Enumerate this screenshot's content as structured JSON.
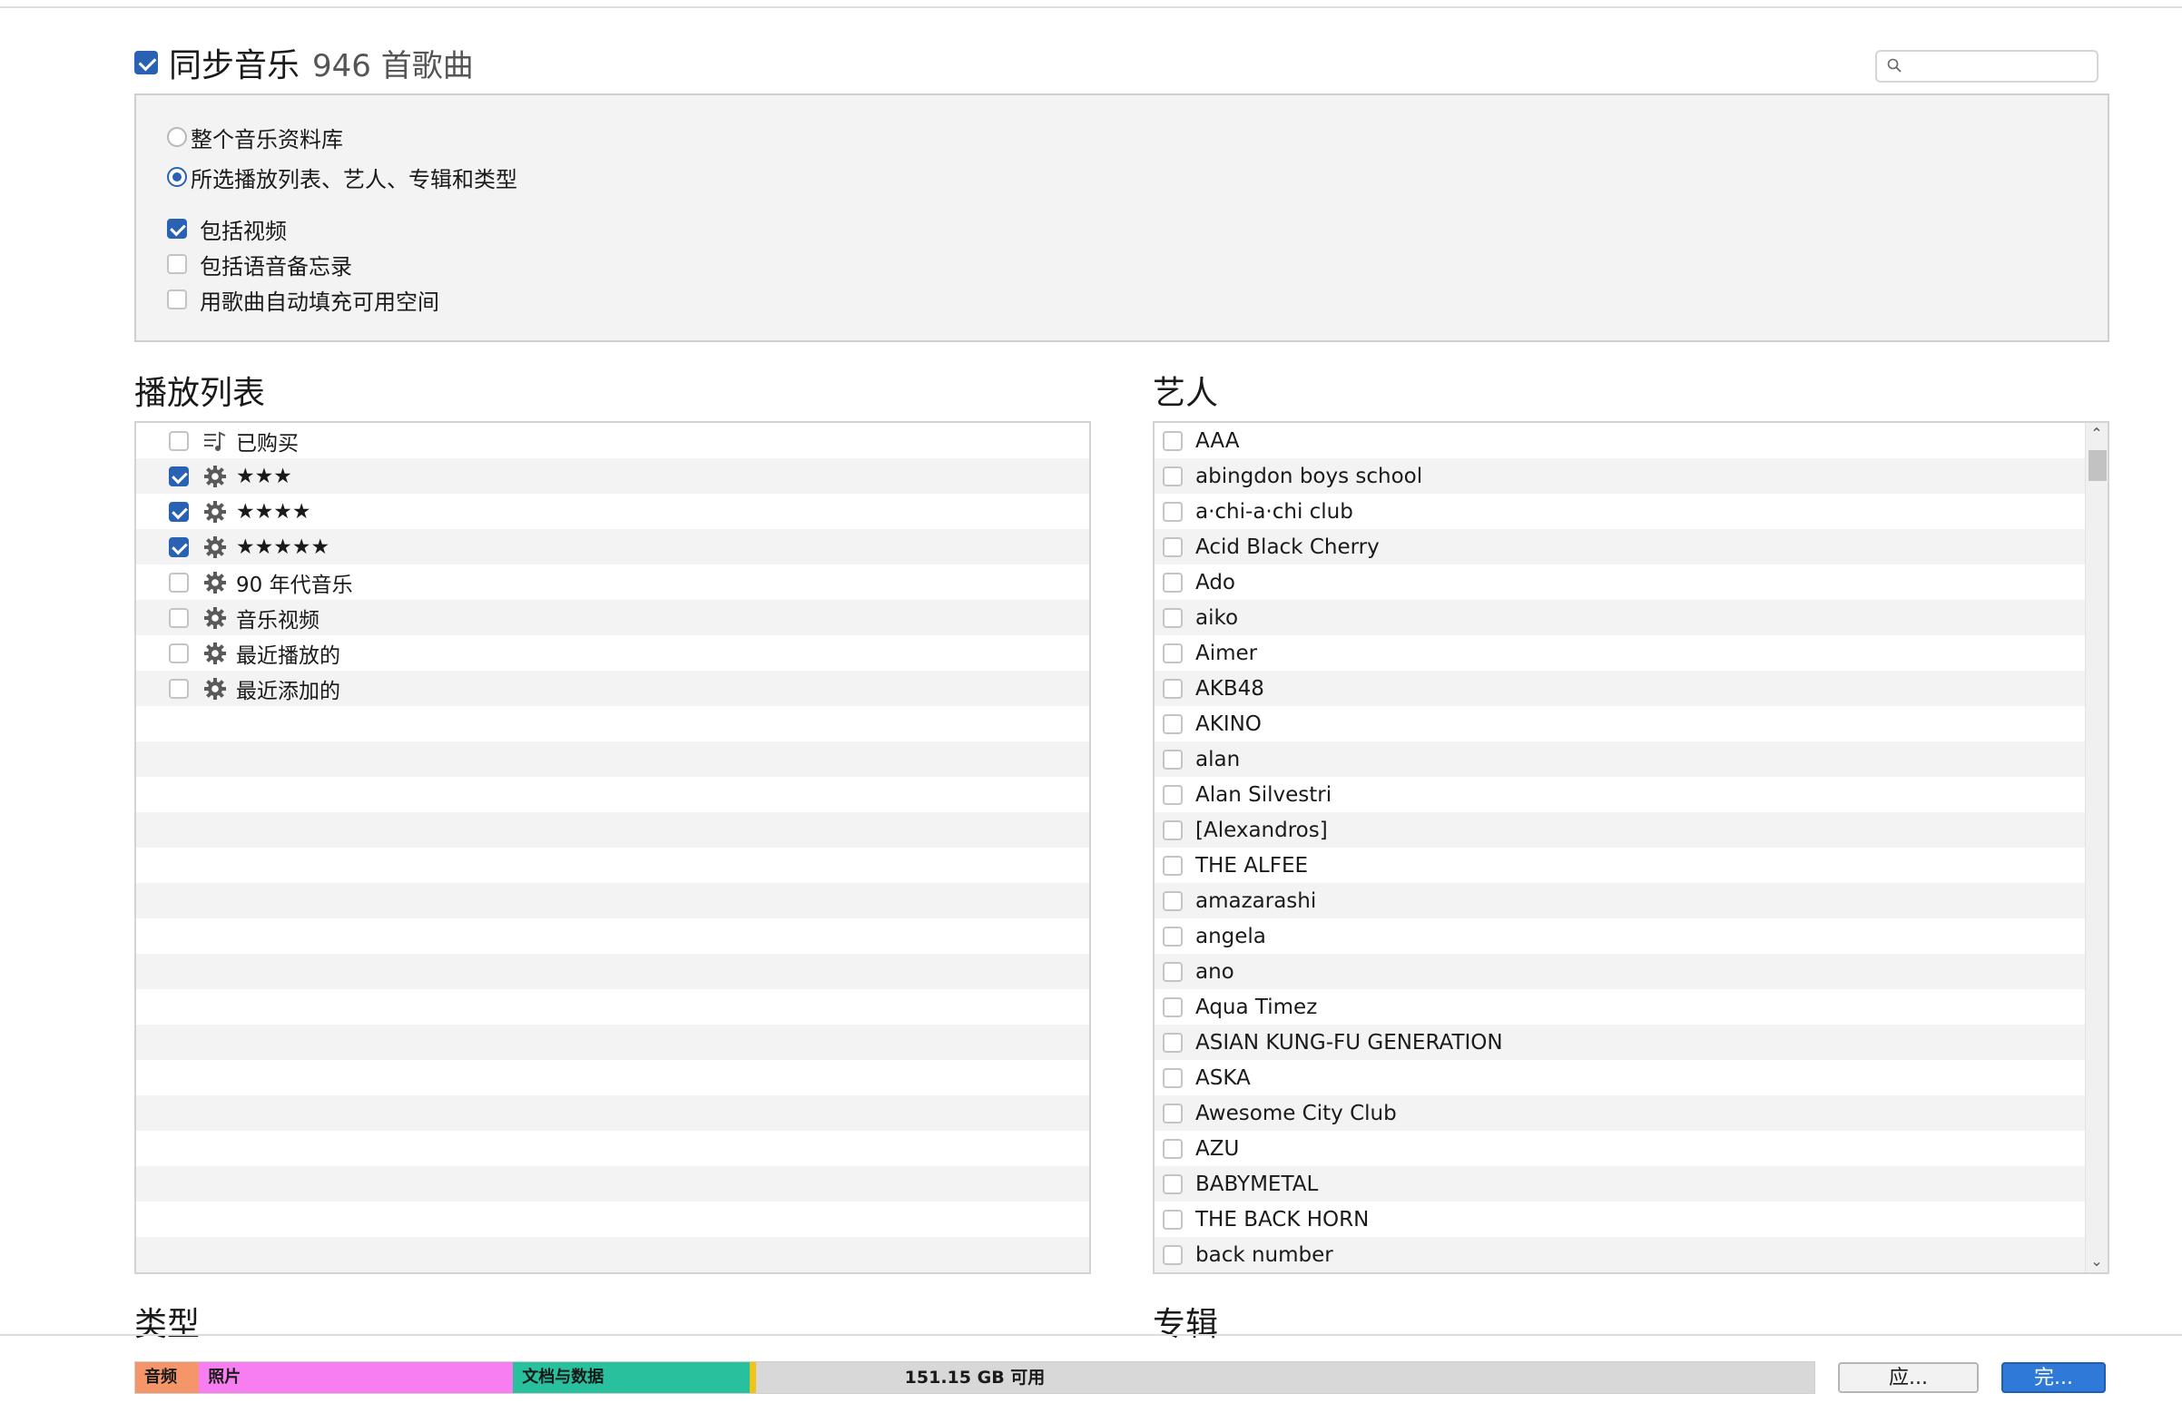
{
  "header": {
    "sync_label": "同步音乐",
    "song_count": "946 首歌曲",
    "sync_checked": true
  },
  "search": {
    "placeholder": ""
  },
  "options": {
    "radio_entire": "整个音乐资料库",
    "radio_selected": "所选播放列表、艺人、专辑和类型",
    "selected_mode": "selected",
    "include_videos": "包括视频",
    "include_videos_checked": true,
    "include_voice_memos": "包括语音备忘录",
    "include_voice_memos_checked": false,
    "autofill": "用歌曲自动填充可用空间",
    "autofill_checked": false
  },
  "sections": {
    "playlists": "播放列表",
    "artists": "艺人",
    "genres": "类型",
    "albums": "专辑"
  },
  "playlists": [
    {
      "name": "已购买",
      "checked": false,
      "icon": "purchased-list-icon"
    },
    {
      "name": "★★★",
      "checked": true,
      "icon": "gear-icon"
    },
    {
      "name": "★★★★",
      "checked": true,
      "icon": "gear-icon"
    },
    {
      "name": "★★★★★",
      "checked": true,
      "icon": "gear-icon"
    },
    {
      "name": "90 年代音乐",
      "checked": false,
      "icon": "gear-icon"
    },
    {
      "name": "音乐视频",
      "checked": false,
      "icon": "gear-icon"
    },
    {
      "name": "最近播放的",
      "checked": false,
      "icon": "gear-icon"
    },
    {
      "name": "最近添加的",
      "checked": false,
      "icon": "gear-icon"
    }
  ],
  "artists": [
    "AAA",
    "abingdon boys school",
    "a·chi-a·chi club",
    "Acid Black Cherry",
    "Ado",
    "aiko",
    "Aimer",
    "AKB48",
    "AKINO",
    "alan",
    "Alan Silvestri",
    "[Alexandros]",
    "THE ALFEE",
    "amazarashi",
    "angela",
    "ano",
    "Aqua Timez",
    "ASIAN KUNG-FU GENERATION",
    "ASKA",
    "Awesome City Club",
    "AZU",
    "BABYMETAL",
    "THE BACK HORN",
    "back number"
  ],
  "storage": {
    "segments": [
      {
        "label": "音频",
        "color": "#f5956a",
        "fraction": 0.038
      },
      {
        "label": "照片",
        "color": "#f77ef0",
        "fraction": 0.187
      },
      {
        "label": "文档与数据",
        "color": "#29c09e",
        "fraction": 0.141
      },
      {
        "label": "",
        "color": "#f0c417",
        "fraction": 0.004
      }
    ],
    "free_label": "151.15 GB 可用"
  },
  "buttons": {
    "apply": "应...",
    "done": "完..."
  },
  "colors": {
    "accent": "#2a62b3",
    "done_button": "#2f7ad8"
  }
}
